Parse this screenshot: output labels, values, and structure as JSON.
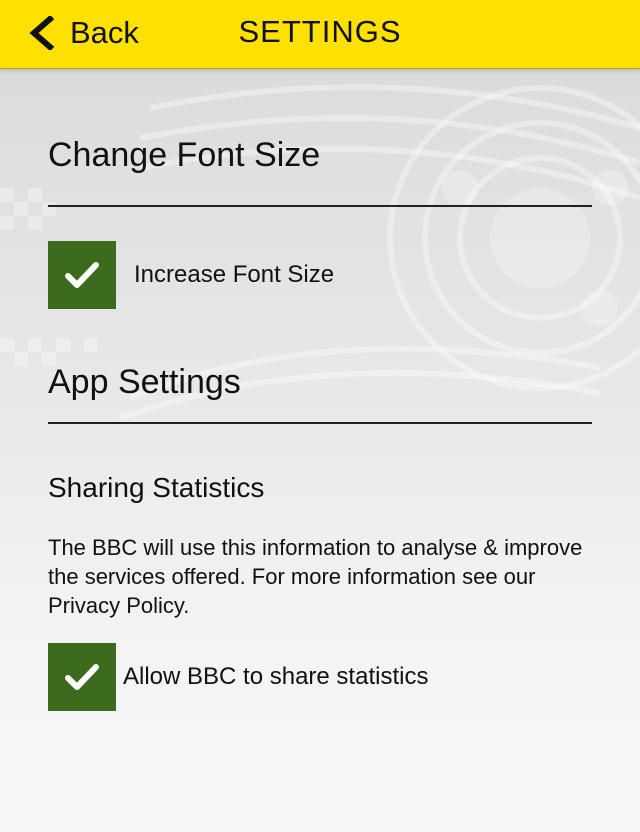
{
  "header": {
    "back_label": "Back",
    "title": "SETTINGS",
    "background_color": "#ffe100"
  },
  "font_section": {
    "title": "Change Font Size",
    "increase_font": {
      "label": "Increase Font Size",
      "checked": true
    }
  },
  "app_section": {
    "title": "App Settings",
    "sharing": {
      "title": "Sharing Statistics",
      "description": "The BBC will use this information to analyse & improve the services offered. For more information see our Privacy Policy.",
      "allow_share": {
        "label": "Allow BBC to share statistics",
        "checked": true
      }
    }
  },
  "colors": {
    "checkbox_fill": "#3d6b1d",
    "checkmark": "#ffffff"
  },
  "icons": {
    "back": "chevron-left-icon",
    "check": "checkmark-icon"
  }
}
